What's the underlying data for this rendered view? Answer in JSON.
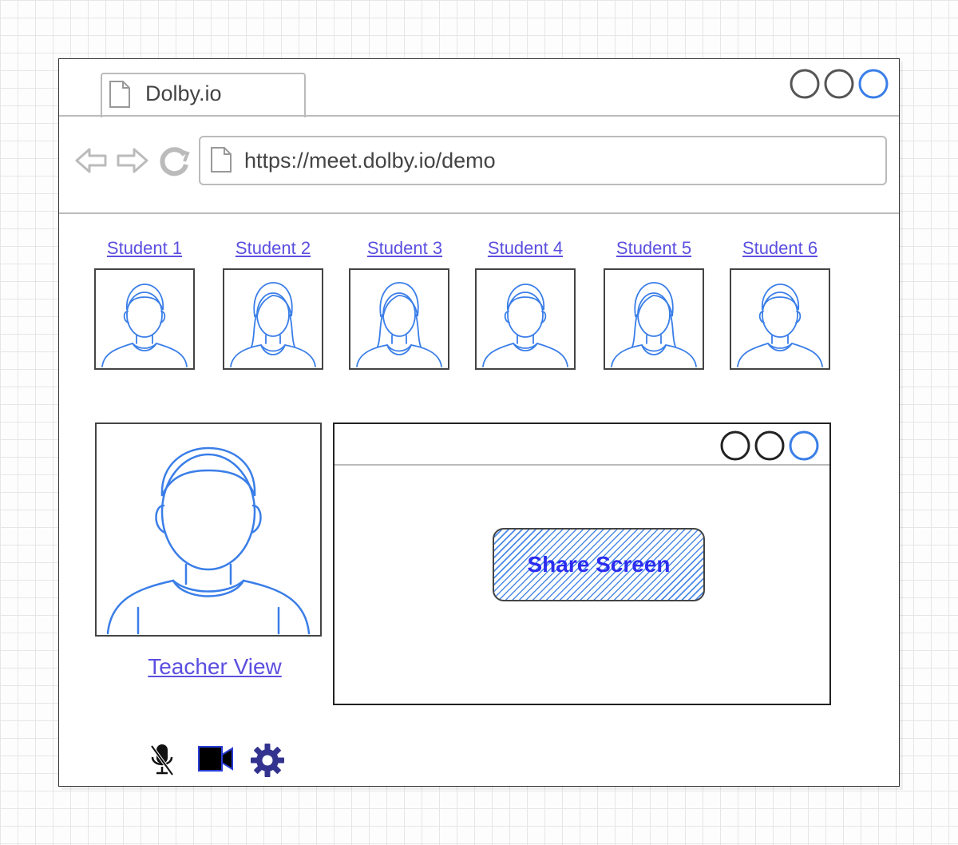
{
  "browser": {
    "tab_title": "Dolby.io",
    "url": "https://meet.dolby.io/demo"
  },
  "students": [
    {
      "label": "Student 1",
      "hair": "short"
    },
    {
      "label": "Student 2",
      "hair": "long"
    },
    {
      "label": "Student 3",
      "hair": "long"
    },
    {
      "label": "Student 4",
      "hair": "short"
    },
    {
      "label": "Student 5",
      "hair": "long"
    },
    {
      "label": "Student 6",
      "hair": "short"
    }
  ],
  "teacher": {
    "label": "Teacher View"
  },
  "share": {
    "button_label": "Share Screen"
  },
  "controls": {
    "icons": [
      "mic-muted-icon",
      "video-camera-icon",
      "settings-gear-icon"
    ]
  },
  "colors": {
    "accent_blue": "#3a7ee8",
    "link_purple": "#5b4fe0",
    "share_text": "#2d2df0"
  }
}
